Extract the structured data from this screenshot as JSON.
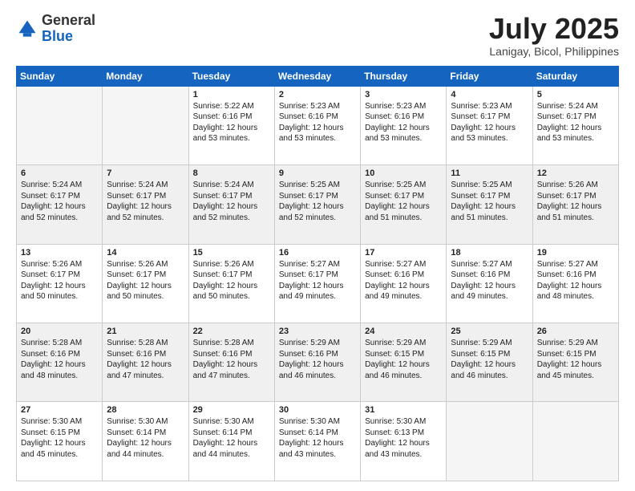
{
  "logo": {
    "general": "General",
    "blue": "Blue"
  },
  "header": {
    "month": "July 2025",
    "location": "Lanigay, Bicol, Philippines"
  },
  "weekdays": [
    "Sunday",
    "Monday",
    "Tuesday",
    "Wednesday",
    "Thursday",
    "Friday",
    "Saturday"
  ],
  "weeks": [
    [
      {
        "day": null,
        "sunrise": null,
        "sunset": null,
        "daylight": null
      },
      {
        "day": null,
        "sunrise": null,
        "sunset": null,
        "daylight": null
      },
      {
        "day": "1",
        "sunrise": "Sunrise: 5:22 AM",
        "sunset": "Sunset: 6:16 PM",
        "daylight": "Daylight: 12 hours and 53 minutes."
      },
      {
        "day": "2",
        "sunrise": "Sunrise: 5:23 AM",
        "sunset": "Sunset: 6:16 PM",
        "daylight": "Daylight: 12 hours and 53 minutes."
      },
      {
        "day": "3",
        "sunrise": "Sunrise: 5:23 AM",
        "sunset": "Sunset: 6:16 PM",
        "daylight": "Daylight: 12 hours and 53 minutes."
      },
      {
        "day": "4",
        "sunrise": "Sunrise: 5:23 AM",
        "sunset": "Sunset: 6:17 PM",
        "daylight": "Daylight: 12 hours and 53 minutes."
      },
      {
        "day": "5",
        "sunrise": "Sunrise: 5:24 AM",
        "sunset": "Sunset: 6:17 PM",
        "daylight": "Daylight: 12 hours and 53 minutes."
      }
    ],
    [
      {
        "day": "6",
        "sunrise": "Sunrise: 5:24 AM",
        "sunset": "Sunset: 6:17 PM",
        "daylight": "Daylight: 12 hours and 52 minutes."
      },
      {
        "day": "7",
        "sunrise": "Sunrise: 5:24 AM",
        "sunset": "Sunset: 6:17 PM",
        "daylight": "Daylight: 12 hours and 52 minutes."
      },
      {
        "day": "8",
        "sunrise": "Sunrise: 5:24 AM",
        "sunset": "Sunset: 6:17 PM",
        "daylight": "Daylight: 12 hours and 52 minutes."
      },
      {
        "day": "9",
        "sunrise": "Sunrise: 5:25 AM",
        "sunset": "Sunset: 6:17 PM",
        "daylight": "Daylight: 12 hours and 52 minutes."
      },
      {
        "day": "10",
        "sunrise": "Sunrise: 5:25 AM",
        "sunset": "Sunset: 6:17 PM",
        "daylight": "Daylight: 12 hours and 51 minutes."
      },
      {
        "day": "11",
        "sunrise": "Sunrise: 5:25 AM",
        "sunset": "Sunset: 6:17 PM",
        "daylight": "Daylight: 12 hours and 51 minutes."
      },
      {
        "day": "12",
        "sunrise": "Sunrise: 5:26 AM",
        "sunset": "Sunset: 6:17 PM",
        "daylight": "Daylight: 12 hours and 51 minutes."
      }
    ],
    [
      {
        "day": "13",
        "sunrise": "Sunrise: 5:26 AM",
        "sunset": "Sunset: 6:17 PM",
        "daylight": "Daylight: 12 hours and 50 minutes."
      },
      {
        "day": "14",
        "sunrise": "Sunrise: 5:26 AM",
        "sunset": "Sunset: 6:17 PM",
        "daylight": "Daylight: 12 hours and 50 minutes."
      },
      {
        "day": "15",
        "sunrise": "Sunrise: 5:26 AM",
        "sunset": "Sunset: 6:17 PM",
        "daylight": "Daylight: 12 hours and 50 minutes."
      },
      {
        "day": "16",
        "sunrise": "Sunrise: 5:27 AM",
        "sunset": "Sunset: 6:17 PM",
        "daylight": "Daylight: 12 hours and 49 minutes."
      },
      {
        "day": "17",
        "sunrise": "Sunrise: 5:27 AM",
        "sunset": "Sunset: 6:16 PM",
        "daylight": "Daylight: 12 hours and 49 minutes."
      },
      {
        "day": "18",
        "sunrise": "Sunrise: 5:27 AM",
        "sunset": "Sunset: 6:16 PM",
        "daylight": "Daylight: 12 hours and 49 minutes."
      },
      {
        "day": "19",
        "sunrise": "Sunrise: 5:27 AM",
        "sunset": "Sunset: 6:16 PM",
        "daylight": "Daylight: 12 hours and 48 minutes."
      }
    ],
    [
      {
        "day": "20",
        "sunrise": "Sunrise: 5:28 AM",
        "sunset": "Sunset: 6:16 PM",
        "daylight": "Daylight: 12 hours and 48 minutes."
      },
      {
        "day": "21",
        "sunrise": "Sunrise: 5:28 AM",
        "sunset": "Sunset: 6:16 PM",
        "daylight": "Daylight: 12 hours and 47 minutes."
      },
      {
        "day": "22",
        "sunrise": "Sunrise: 5:28 AM",
        "sunset": "Sunset: 6:16 PM",
        "daylight": "Daylight: 12 hours and 47 minutes."
      },
      {
        "day": "23",
        "sunrise": "Sunrise: 5:29 AM",
        "sunset": "Sunset: 6:16 PM",
        "daylight": "Daylight: 12 hours and 46 minutes."
      },
      {
        "day": "24",
        "sunrise": "Sunrise: 5:29 AM",
        "sunset": "Sunset: 6:15 PM",
        "daylight": "Daylight: 12 hours and 46 minutes."
      },
      {
        "day": "25",
        "sunrise": "Sunrise: 5:29 AM",
        "sunset": "Sunset: 6:15 PM",
        "daylight": "Daylight: 12 hours and 46 minutes."
      },
      {
        "day": "26",
        "sunrise": "Sunrise: 5:29 AM",
        "sunset": "Sunset: 6:15 PM",
        "daylight": "Daylight: 12 hours and 45 minutes."
      }
    ],
    [
      {
        "day": "27",
        "sunrise": "Sunrise: 5:30 AM",
        "sunset": "Sunset: 6:15 PM",
        "daylight": "Daylight: 12 hours and 45 minutes."
      },
      {
        "day": "28",
        "sunrise": "Sunrise: 5:30 AM",
        "sunset": "Sunset: 6:14 PM",
        "daylight": "Daylight: 12 hours and 44 minutes."
      },
      {
        "day": "29",
        "sunrise": "Sunrise: 5:30 AM",
        "sunset": "Sunset: 6:14 PM",
        "daylight": "Daylight: 12 hours and 44 minutes."
      },
      {
        "day": "30",
        "sunrise": "Sunrise: 5:30 AM",
        "sunset": "Sunset: 6:14 PM",
        "daylight": "Daylight: 12 hours and 43 minutes."
      },
      {
        "day": "31",
        "sunrise": "Sunrise: 5:30 AM",
        "sunset": "Sunset: 6:13 PM",
        "daylight": "Daylight: 12 hours and 43 minutes."
      },
      {
        "day": null,
        "sunrise": null,
        "sunset": null,
        "daylight": null
      },
      {
        "day": null,
        "sunrise": null,
        "sunset": null,
        "daylight": null
      }
    ]
  ]
}
